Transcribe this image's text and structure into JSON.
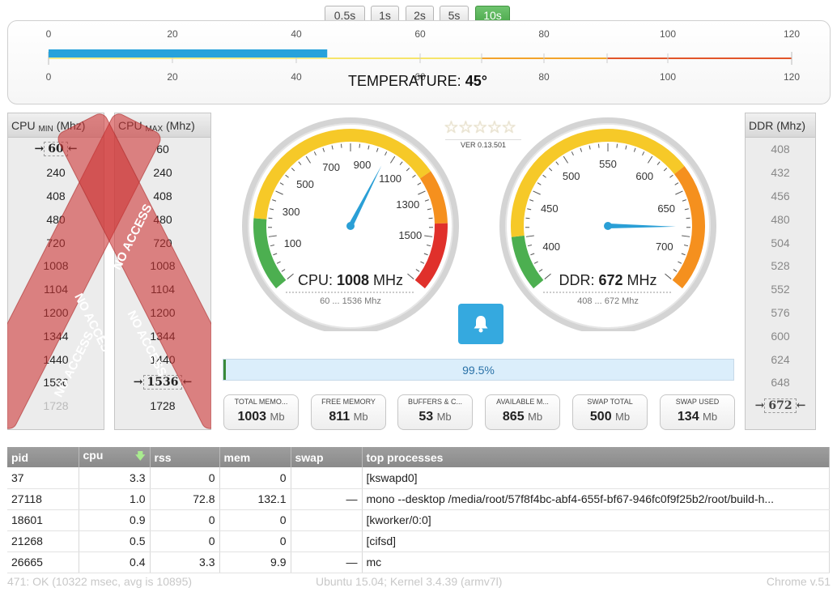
{
  "intervals": [
    {
      "label": "0.5s",
      "active": false
    },
    {
      "label": "1s",
      "active": false
    },
    {
      "label": "2s",
      "active": false
    },
    {
      "label": "5s",
      "active": false
    },
    {
      "label": "10s",
      "active": true
    }
  ],
  "temperature": {
    "label": "TEMPERATURE:",
    "value": "45°",
    "value_number": 45,
    "scale_min": 0,
    "scale_max": 120,
    "ticks": [
      "0",
      "20",
      "40",
      "60",
      "80",
      "100",
      "120"
    ]
  },
  "cpu_min": {
    "title": "CPU",
    "sub": "MIN",
    "unit": "(Mhz)",
    "items": [
      "60",
      "240",
      "408",
      "480",
      "720",
      "1008",
      "1104",
      "1200",
      "1344",
      "1440",
      "1536",
      "1728"
    ],
    "marked": "60"
  },
  "cpu_max": {
    "title": "CPU",
    "sub": "MAX",
    "unit": "(Mhz)",
    "items": [
      "60",
      "240",
      "408",
      "480",
      "720",
      "1008",
      "1104",
      "1200",
      "1344",
      "1440",
      "1536",
      "1728"
    ],
    "marked": "1536"
  },
  "no_access": "NO ACCESS",
  "ddr": {
    "title": "DDR (Mhz)",
    "items": [
      "408",
      "432",
      "456",
      "480",
      "504",
      "528",
      "552",
      "576",
      "600",
      "624",
      "648",
      "672"
    ],
    "marked": "672"
  },
  "version": "VER 0.13.501",
  "cpu_gauge": {
    "label": "CPU:",
    "value": "1008",
    "unit": "MHz",
    "range": "60 ... 1536 Mhz",
    "ticks": [
      "100",
      "300",
      "500",
      "700",
      "900",
      "1100",
      "1300",
      "1500"
    ]
  },
  "ddr_gauge": {
    "label": "DDR:",
    "value": "672",
    "unit": "MHz",
    "range": "408 ... 672 Mhz",
    "ticks": [
      "400",
      "450",
      "500",
      "550",
      "600",
      "650",
      "700"
    ]
  },
  "progress": {
    "text": "99.5%",
    "fraction": 0.005
  },
  "memory": [
    {
      "label": "TOTAL MEMO...",
      "value": "1003",
      "unit": "Mb"
    },
    {
      "label": "FREE MEMORY",
      "value": "811",
      "unit": "Mb"
    },
    {
      "label": "BUFFERS & C...",
      "value": "53",
      "unit": "Mb"
    },
    {
      "label": "AVAILABLE M...",
      "value": "865",
      "unit": "Mb"
    },
    {
      "label": "SWAP TOTAL",
      "value": "500",
      "unit": "Mb"
    },
    {
      "label": "SWAP USED",
      "value": "134",
      "unit": "Mb"
    }
  ],
  "table": {
    "headers": [
      "pid",
      "cpu",
      "rss",
      "mem",
      "swap",
      "top processes"
    ],
    "rows": [
      [
        "37",
        "3.3",
        "0",
        "0",
        "",
        "[kswapd0]"
      ],
      [
        "27118",
        "1.0",
        "72.8",
        "132.1",
        "—",
        "mono --desktop /media/root/57f8f4bc-abf4-655f-bf67-946fc0f9f25b2/root/build-h..."
      ],
      [
        "18601",
        "0.9",
        "0",
        "0",
        "",
        "[kworker/0:0]"
      ],
      [
        "21268",
        "0.5",
        "0",
        "0",
        "",
        "[cifsd]"
      ],
      [
        "26665",
        "0.4",
        "3.3",
        "9.9",
        "—",
        "mc"
      ]
    ]
  },
  "footer": {
    "status": "471: OK (10322 msec, avg is 10895)",
    "system": "Ubuntu 15.04; Kernel 3.4.39 (armv7l)",
    "browser": "Chrome v.51"
  }
}
